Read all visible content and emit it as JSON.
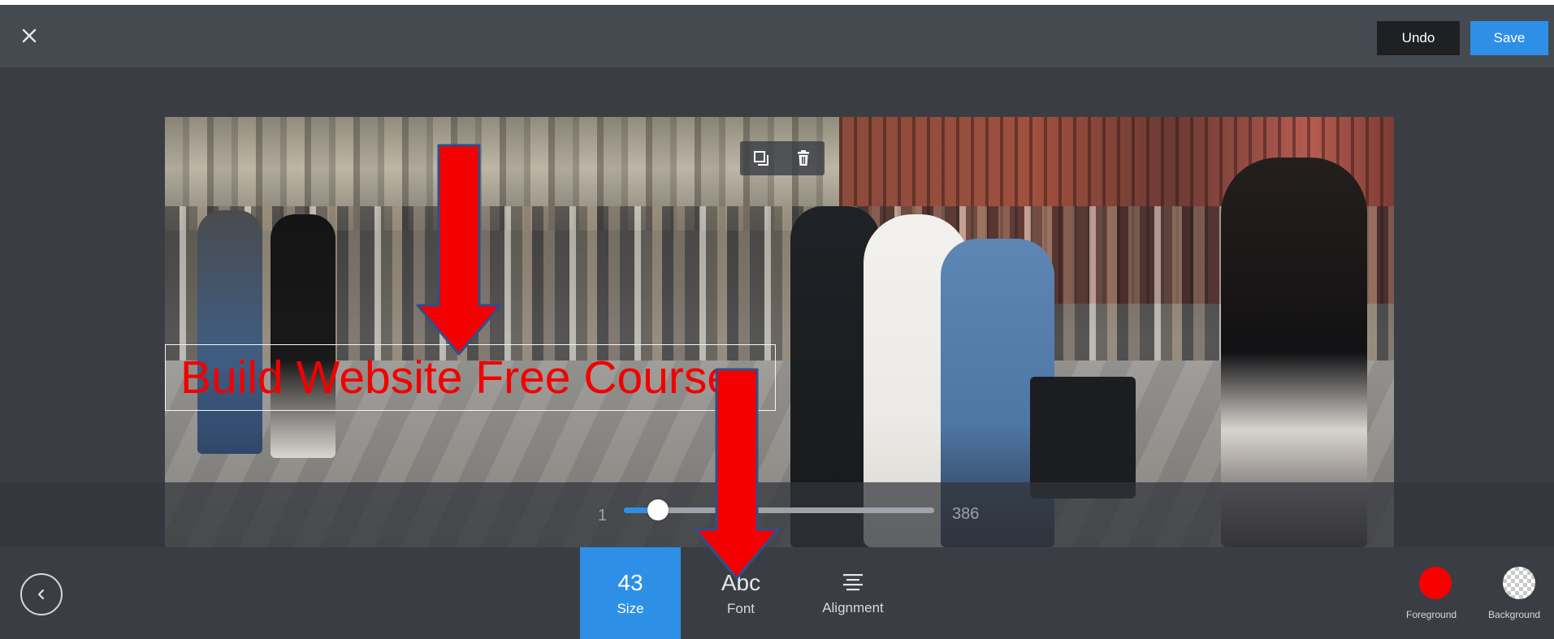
{
  "header": {
    "close_icon": "close-icon",
    "undo_label": "Undo",
    "save_label": "Save",
    "accent_color": "#2e8fe6"
  },
  "canvas": {
    "text_layer": {
      "text": "Build Website Free Course",
      "color": "#f20000"
    },
    "object_toolbar": {
      "duplicate_icon": "duplicate-icon",
      "delete_icon": "trash-icon"
    }
  },
  "size_slider": {
    "min_label": "1",
    "max_label": "386",
    "value_label": "43",
    "min": 1,
    "max": 386,
    "value": 43
  },
  "bottom_toolbar": {
    "back_icon": "chevron-left-icon",
    "tabs": [
      {
        "value": "43",
        "label": "Size",
        "active": true
      },
      {
        "value": "Abc",
        "label": "Font",
        "active": false
      },
      {
        "icon": "text-align-icon",
        "label": "Alignment",
        "active": false
      }
    ],
    "foreground": {
      "label": "Foreground",
      "color": "#f60000"
    },
    "background": {
      "label": "Background",
      "color": "transparent"
    }
  }
}
